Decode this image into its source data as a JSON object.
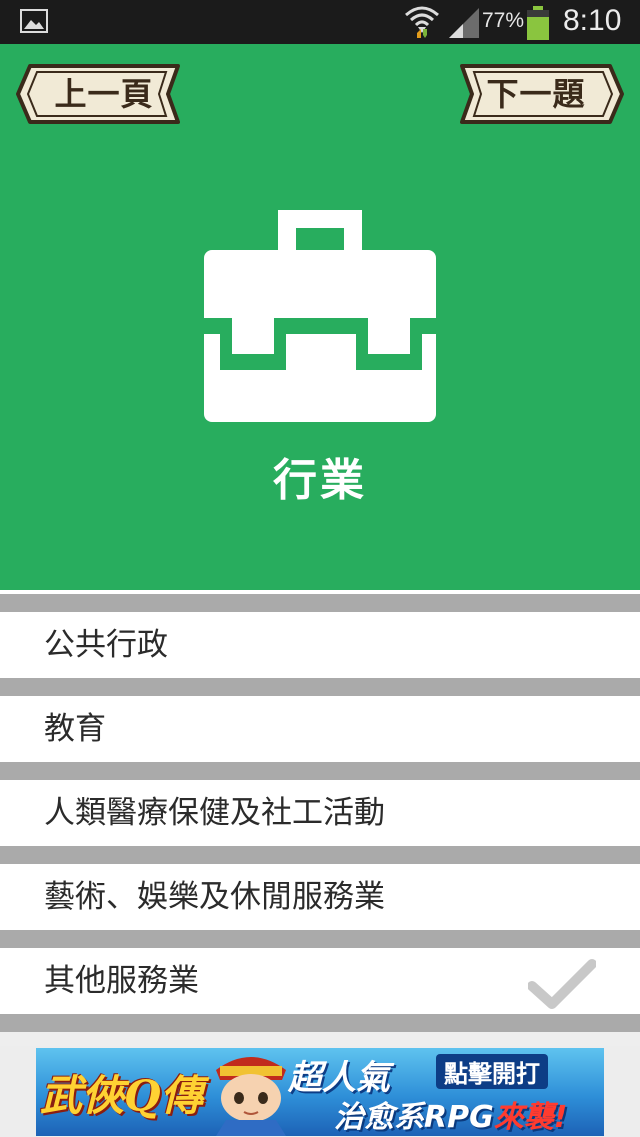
{
  "status_bar": {
    "battery_percent": "77%",
    "time": "8:10",
    "icons": [
      "gallery-icon",
      "wifi-icon",
      "signal-icon",
      "battery-icon"
    ]
  },
  "header": {
    "prev_label": "上一頁",
    "next_label": "下一題",
    "category_icon": "briefcase-icon",
    "category_title": "行業",
    "bg_color": "#28ad5e"
  },
  "options": [
    {
      "label": "公共行政",
      "selected": false
    },
    {
      "label": "教育",
      "selected": false
    },
    {
      "label": "人類醫療保健及社工活動",
      "selected": false
    },
    {
      "label": "藝術、娛樂及休閒服務業",
      "selected": false
    },
    {
      "label": "其他服務業",
      "selected": true
    }
  ],
  "ad": {
    "game_logo": "武俠Q傳",
    "headline": "超人氣",
    "cta": "點擊開打",
    "tagline_prefix": "治愈系RPG",
    "tagline_emphasis": "來襲!"
  }
}
